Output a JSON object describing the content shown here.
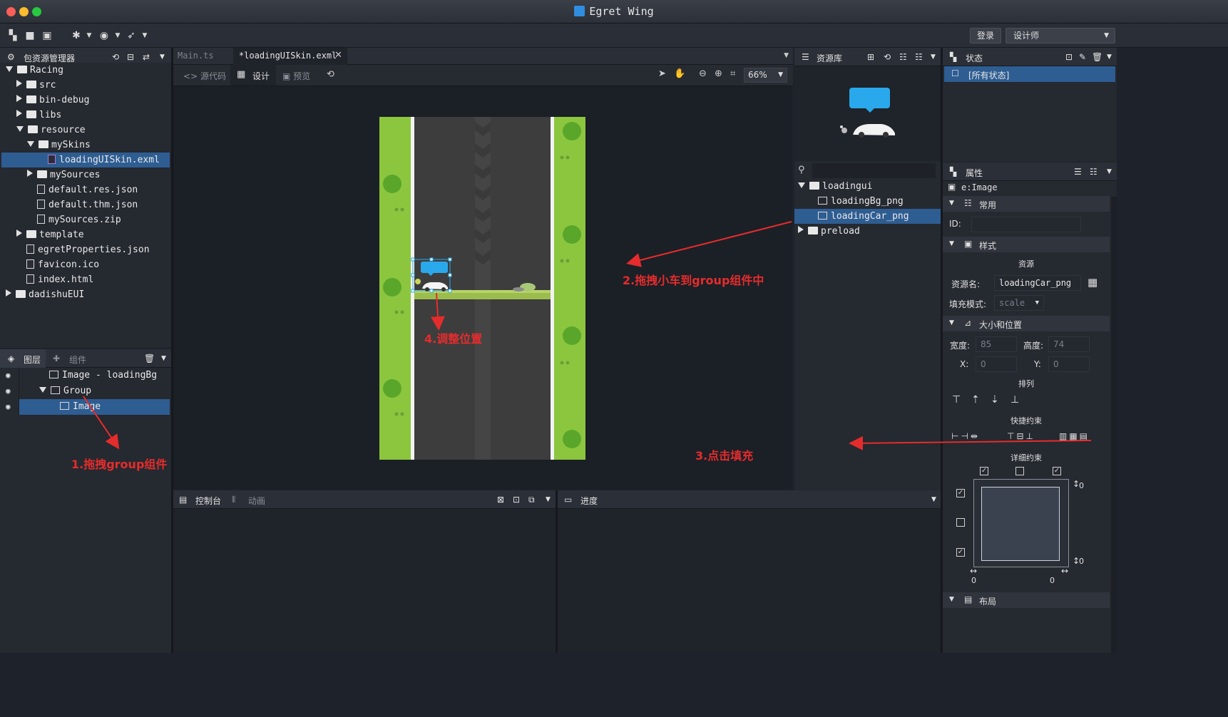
{
  "app": {
    "title": "Egret Wing"
  },
  "toolbar": {
    "login": "登录",
    "layout": "设计师"
  },
  "project_panel": {
    "title": "包资源管理器",
    "tree": [
      {
        "label": "Racing",
        "depth": 0,
        "type": "root",
        "open": true
      },
      {
        "label": "src",
        "depth": 1,
        "type": "pkg",
        "open": false
      },
      {
        "label": "bin-debug",
        "depth": 1,
        "type": "folder",
        "open": false
      },
      {
        "label": "libs",
        "depth": 1,
        "type": "folder",
        "open": false
      },
      {
        "label": "resource",
        "depth": 1,
        "type": "folder",
        "open": true
      },
      {
        "label": "mySkins",
        "depth": 2,
        "type": "folder",
        "open": true
      },
      {
        "label": "loadingUISkin.exml",
        "depth": 3,
        "type": "exml",
        "selected": true
      },
      {
        "label": "mySources",
        "depth": 2,
        "type": "folder",
        "open": false
      },
      {
        "label": "default.res.json",
        "depth": 2,
        "type": "file"
      },
      {
        "label": "default.thm.json",
        "depth": 2,
        "type": "file"
      },
      {
        "label": "mySources.zip",
        "depth": 2,
        "type": "file"
      },
      {
        "label": "template",
        "depth": 1,
        "type": "folder",
        "open": false
      },
      {
        "label": "egretProperties.json",
        "depth": 1,
        "type": "file"
      },
      {
        "label": "favicon.ico",
        "depth": 1,
        "type": "file"
      },
      {
        "label": "index.html",
        "depth": 1,
        "type": "file"
      },
      {
        "label": "dadishuEUI",
        "depth": 0,
        "type": "root",
        "open": false
      }
    ]
  },
  "layers_panel": {
    "tab_layers": "图层",
    "tab_components": "组件",
    "items": [
      {
        "label": "Image - loadingBg",
        "depth": 0
      },
      {
        "label": "Group",
        "depth": 0,
        "open": true
      },
      {
        "label": "Image",
        "depth": 1,
        "selected": true
      }
    ]
  },
  "editor": {
    "tabs": [
      {
        "label": "Main.ts"
      },
      {
        "label": "*loadingUISkin.exml",
        "active": true
      }
    ],
    "mode_source": "源代码",
    "mode_design": "设计",
    "mode_preview": "预览",
    "zoom": "66%"
  },
  "resources_panel": {
    "title": "资源库",
    "tree": [
      {
        "label": "loadingui",
        "depth": 0,
        "type": "folder",
        "open": true
      },
      {
        "label": "loadingBg_png",
        "depth": 1,
        "type": "img"
      },
      {
        "label": "loadingCar_png",
        "depth": 1,
        "type": "img",
        "selected": true
      },
      {
        "label": "preload",
        "depth": 0,
        "type": "folder",
        "open": false
      }
    ]
  },
  "states_panel": {
    "title": "状态",
    "all_states": "[所有状态]"
  },
  "props_panel": {
    "title": "属性",
    "type": "e:Image",
    "sec_common": "常用",
    "id_label": "ID:",
    "sec_style": "样式",
    "res_heading": "资源",
    "res_name_label": "资源名:",
    "res_name_value": "loadingCar_png",
    "fill_label": "填充模式:",
    "fill_value": "scale",
    "sec_size": "大小和位置",
    "width_label": "宽度:",
    "width_value": "85",
    "height_label": "高度:",
    "height_value": "74",
    "x_label": "X:",
    "x_value": "0",
    "y_label": "Y:",
    "y_value": "0",
    "align_heading": "排列",
    "quick_heading": "快捷约束",
    "detail_heading": "详细约束",
    "c_top": "0",
    "c_bottom": "0",
    "c_left": "0",
    "c_right": "0",
    "sec_layout": "布局"
  },
  "bottom": {
    "console": "控制台",
    "animation": "动画",
    "progress": "进度"
  },
  "annotations": {
    "a1": "1.拖拽group组件",
    "a2": "2.拖拽小车到group组件中",
    "a3": "3.点击填充",
    "a4": "4.调整位置"
  },
  "colors": {
    "grass": "#8cc63f",
    "road": "#3d3d3d",
    "selection": "#2e5d92",
    "accent": "#29a9ec"
  }
}
